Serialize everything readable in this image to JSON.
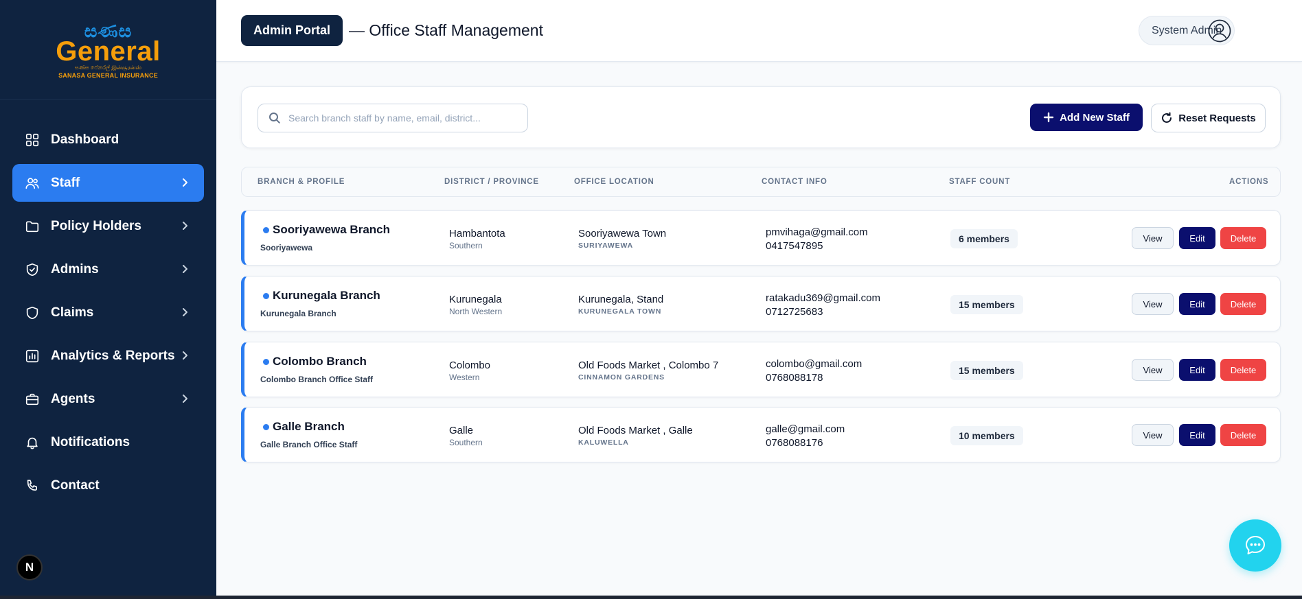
{
  "brand": {
    "script_text": "සණස",
    "main_text": "General",
    "tagline": "සණස ජෙනරල් இன்சூரன்ஸ்",
    "subtitle": "SANASA GENERAL INSURANCE"
  },
  "sidebar": {
    "items": [
      {
        "label": "Dashboard",
        "icon": "dashboard-icon",
        "has_chevron": false,
        "active": false
      },
      {
        "label": "Staff",
        "icon": "users-icon",
        "has_chevron": true,
        "active": true
      },
      {
        "label": "Policy Holders",
        "icon": "folder-icon",
        "has_chevron": true,
        "active": false
      },
      {
        "label": "Admins",
        "icon": "shield-check-icon",
        "has_chevron": true,
        "active": false
      },
      {
        "label": "Claims",
        "icon": "shield-icon",
        "has_chevron": true,
        "active": false
      },
      {
        "label": "Analytics & Reports",
        "icon": "bar-chart-icon",
        "has_chevron": true,
        "active": false
      },
      {
        "label": "Agents",
        "icon": "briefcase-icon",
        "has_chevron": true,
        "active": false
      },
      {
        "label": "Notifications",
        "icon": "bell-icon",
        "has_chevron": false,
        "active": false
      },
      {
        "label": "Contact",
        "icon": "phone-icon",
        "has_chevron": false,
        "active": false
      }
    ],
    "dev_badge": "N"
  },
  "header": {
    "portal_label": "Admin Portal",
    "title": "— Office Staff Management",
    "user_label": "System Admin"
  },
  "toolbar": {
    "search_placeholder": "Search branch staff by name, email, district...",
    "search_value": "",
    "add_label": "Add New Staff",
    "reset_label": "Reset Requests"
  },
  "table": {
    "columns": [
      "BRANCH & PROFILE",
      "DISTRICT / PROVINCE",
      "OFFICE LOCATION",
      "CONTACT INFO",
      "STAFF COUNT",
      "ACTIONS"
    ],
    "rows": [
      {
        "name": "Sooriyawewa Branch",
        "profile": "Sooriyawewa",
        "district": "Hambantota",
        "province": "Southern",
        "location": "Sooriyawewa Town",
        "location_area": "SURIYAWEWA",
        "email": "pmvihaga@gmail.com",
        "phone": "0417547895",
        "staff_count": "6 members"
      },
      {
        "name": "Kurunegala Branch",
        "profile": "Kurunegala Branch",
        "district": "Kurunegala",
        "province": "North Western",
        "location": "Kurunegala, Stand",
        "location_area": "KURUNEGALA TOWN",
        "email": "ratakadu369@gmail.com",
        "phone": "0712725683",
        "staff_count": "15 members"
      },
      {
        "name": "Colombo Branch",
        "profile": "Colombo Branch Office Staff",
        "district": "Colombo",
        "province": "Western",
        "location": "Old Foods Market , Colombo 7",
        "location_area": "CINNAMON GARDENS",
        "email": "colombo@gmail.com",
        "phone": "0768088178",
        "staff_count": "15 members"
      },
      {
        "name": "Galle Branch",
        "profile": "Galle Branch Office Staff",
        "district": "Galle",
        "province": "Southern",
        "location": "Old Foods Market , Galle",
        "location_area": "KALUWELLA",
        "email": "galle@gmail.com",
        "phone": "0768088176",
        "staff_count": "10 members"
      }
    ],
    "actions": {
      "view": "View",
      "edit": "Edit",
      "delete": "Delete"
    }
  },
  "colors": {
    "sidebar_bg": "#0f2340",
    "active_nav": "#2b7cf0",
    "primary_button": "#0b0f6e",
    "danger": "#ef4444",
    "chat_fab": "#22d3ee",
    "brand_orange": "#f59e0b"
  },
  "chat": {
    "icon": "chat-bubble-icon"
  }
}
